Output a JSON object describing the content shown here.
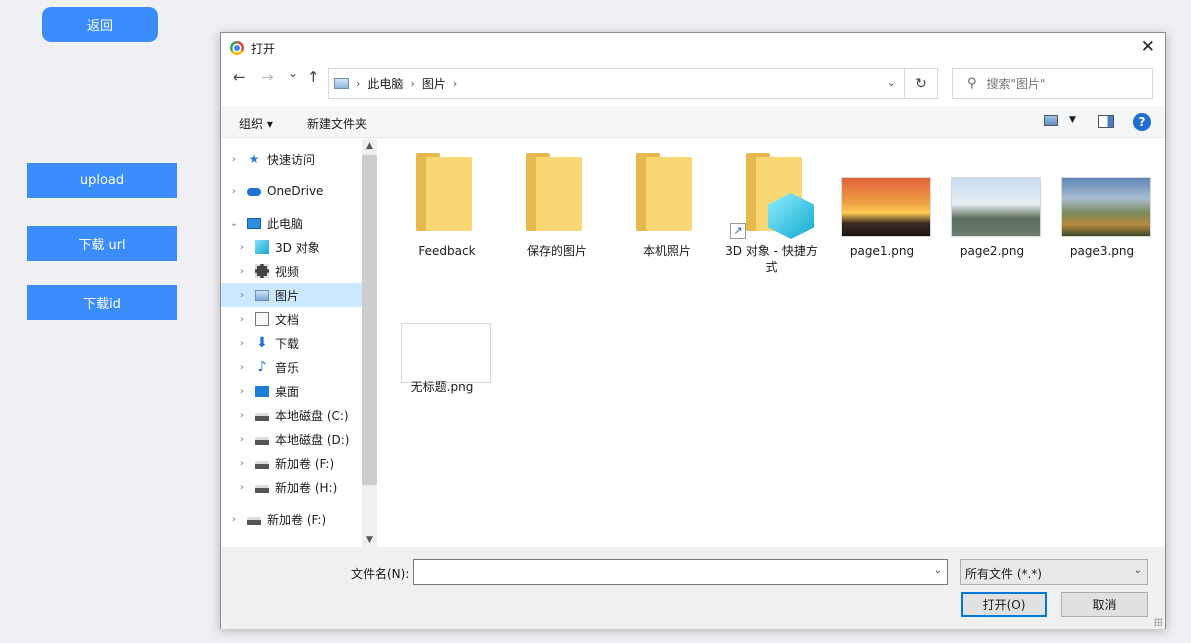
{
  "page": {
    "back_label": "返回",
    "upload_label": "upload",
    "download_url_label": "下载 url",
    "download_id_label": "下载id"
  },
  "dialog": {
    "title": "打开",
    "close_glyph": "✕",
    "nav": {
      "back": "←",
      "forward": "→",
      "recent": "⌄",
      "up": "↑"
    },
    "breadcrumbs": [
      "此电脑",
      "图片"
    ],
    "refresh_glyph": "↻",
    "search_placeholder": "搜索\"图片\"",
    "toolbar": {
      "organize": "组织 ▾",
      "new_folder": "新建文件夹",
      "help": "?"
    },
    "tree": [
      {
        "label": "快速访问",
        "icon": "star-icon"
      },
      {
        "label": "OneDrive",
        "icon": "cloud-icon"
      },
      {
        "label": "此电脑",
        "icon": "computer-icon"
      },
      {
        "label": "3D 对象",
        "icon": "cube-icon"
      },
      {
        "label": "视频",
        "icon": "film-icon"
      },
      {
        "label": "图片",
        "icon": "picture-icon"
      },
      {
        "label": "文档",
        "icon": "document-icon"
      },
      {
        "label": "下载",
        "icon": "download-icon"
      },
      {
        "label": "音乐",
        "icon": "music-icon"
      },
      {
        "label": "桌面",
        "icon": "desktop-icon"
      },
      {
        "label": "本地磁盘 (C:)",
        "icon": "drive-icon"
      },
      {
        "label": "本地磁盘 (D:)",
        "icon": "drive-icon"
      },
      {
        "label": "新加卷 (F:)",
        "icon": "drive-icon"
      },
      {
        "label": "新加卷 (H:)",
        "icon": "drive-icon"
      },
      {
        "label": "新加卷 (F:)",
        "icon": "drive-icon"
      }
    ],
    "files": [
      {
        "name": "Feedback",
        "type": "folder"
      },
      {
        "name": "保存的图片",
        "type": "folder"
      },
      {
        "name": "本机照片",
        "type": "folder"
      },
      {
        "name": "3D 对象 - 快捷方式",
        "type": "shortcut"
      },
      {
        "name": "page1.png",
        "type": "image"
      },
      {
        "name": "page2.png",
        "type": "image"
      },
      {
        "name": "page3.png",
        "type": "image"
      },
      {
        "name": "无标题.png",
        "type": "image"
      }
    ],
    "filename_label": "文件名(N):",
    "filename_value": "",
    "filter_value": "所有文件 (*.*)",
    "open_label": "打开(O)",
    "cancel_label": "取消"
  }
}
